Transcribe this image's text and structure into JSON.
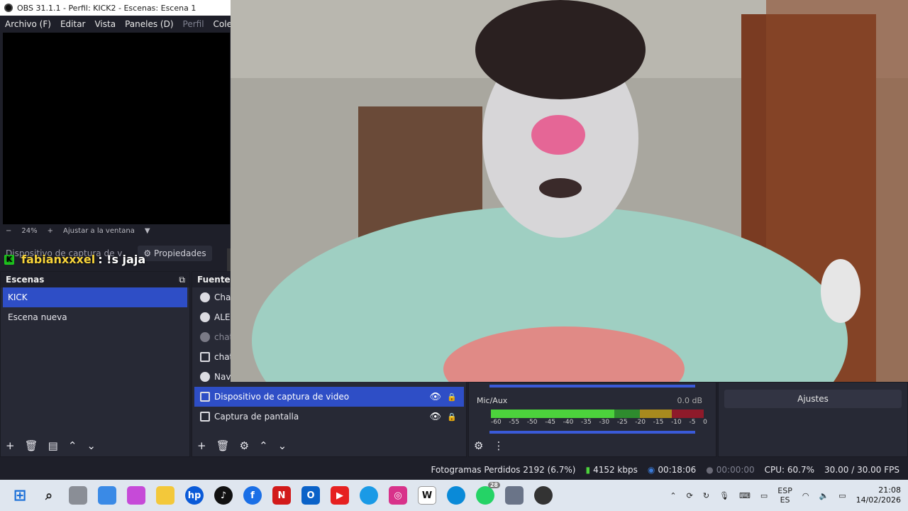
{
  "window": {
    "title": "OBS 31.1.1 - Perfil: KICK2 - Escenas: Escena 1"
  },
  "menu": {
    "items": [
      "Archivo (F)",
      "Editar",
      "Vista",
      "Paneles (D)",
      "Perfil",
      "Colecc"
    ]
  },
  "preview": {
    "zoom": "24%",
    "fit_label": "Ajustar a la ventana",
    "minus": "−",
    "plus": "+"
  },
  "source_bar": {
    "selected_source": "Dispositivo de captura de v",
    "properties_label": "Propiedades"
  },
  "chat": {
    "user": "fabianxxxel",
    "message": ": !s jaja",
    "badge": "K"
  },
  "scenes": {
    "title": "Escenas",
    "items": [
      {
        "label": "KICK"
      },
      {
        "label": "Escena nueva"
      }
    ]
  },
  "sources": {
    "title": "Fuentes",
    "items": [
      {
        "label": "Chat"
      },
      {
        "label": "ALEF"
      },
      {
        "label": "chat"
      },
      {
        "label": "chat"
      },
      {
        "label": "Navegador"
      },
      {
        "label": "Dispositivo de captura de video"
      },
      {
        "label": "Captura de pantalla"
      }
    ]
  },
  "mixer": {
    "channel": "Mic/Aux",
    "level": "0.0 dB",
    "ticks": [
      "-60",
      "-55",
      "-50",
      "-45",
      "-40",
      "-35",
      "-30",
      "-25",
      "-20",
      "-15",
      "-10",
      "-5",
      "0"
    ]
  },
  "controls": {
    "settings_label": "Ajustes"
  },
  "status": {
    "dropped_frames": "Fotogramas Perdidos 2192 (6.7%)",
    "bitrate": "4152 kbps",
    "stream_time": "00:18:06",
    "rec_time": "00:00:00",
    "cpu": "CPU: 60.7%",
    "fps": "30.00 / 30.00 FPS"
  },
  "taskbar": {
    "lang_top": "ESP",
    "lang_bottom": "ES",
    "time": "21:08",
    "date": "14/02/2026",
    "whatsapp_badge": "28"
  },
  "colors": {
    "accent": "#2e4ec6",
    "panel": "#272935",
    "bg": "#1e1f29"
  }
}
